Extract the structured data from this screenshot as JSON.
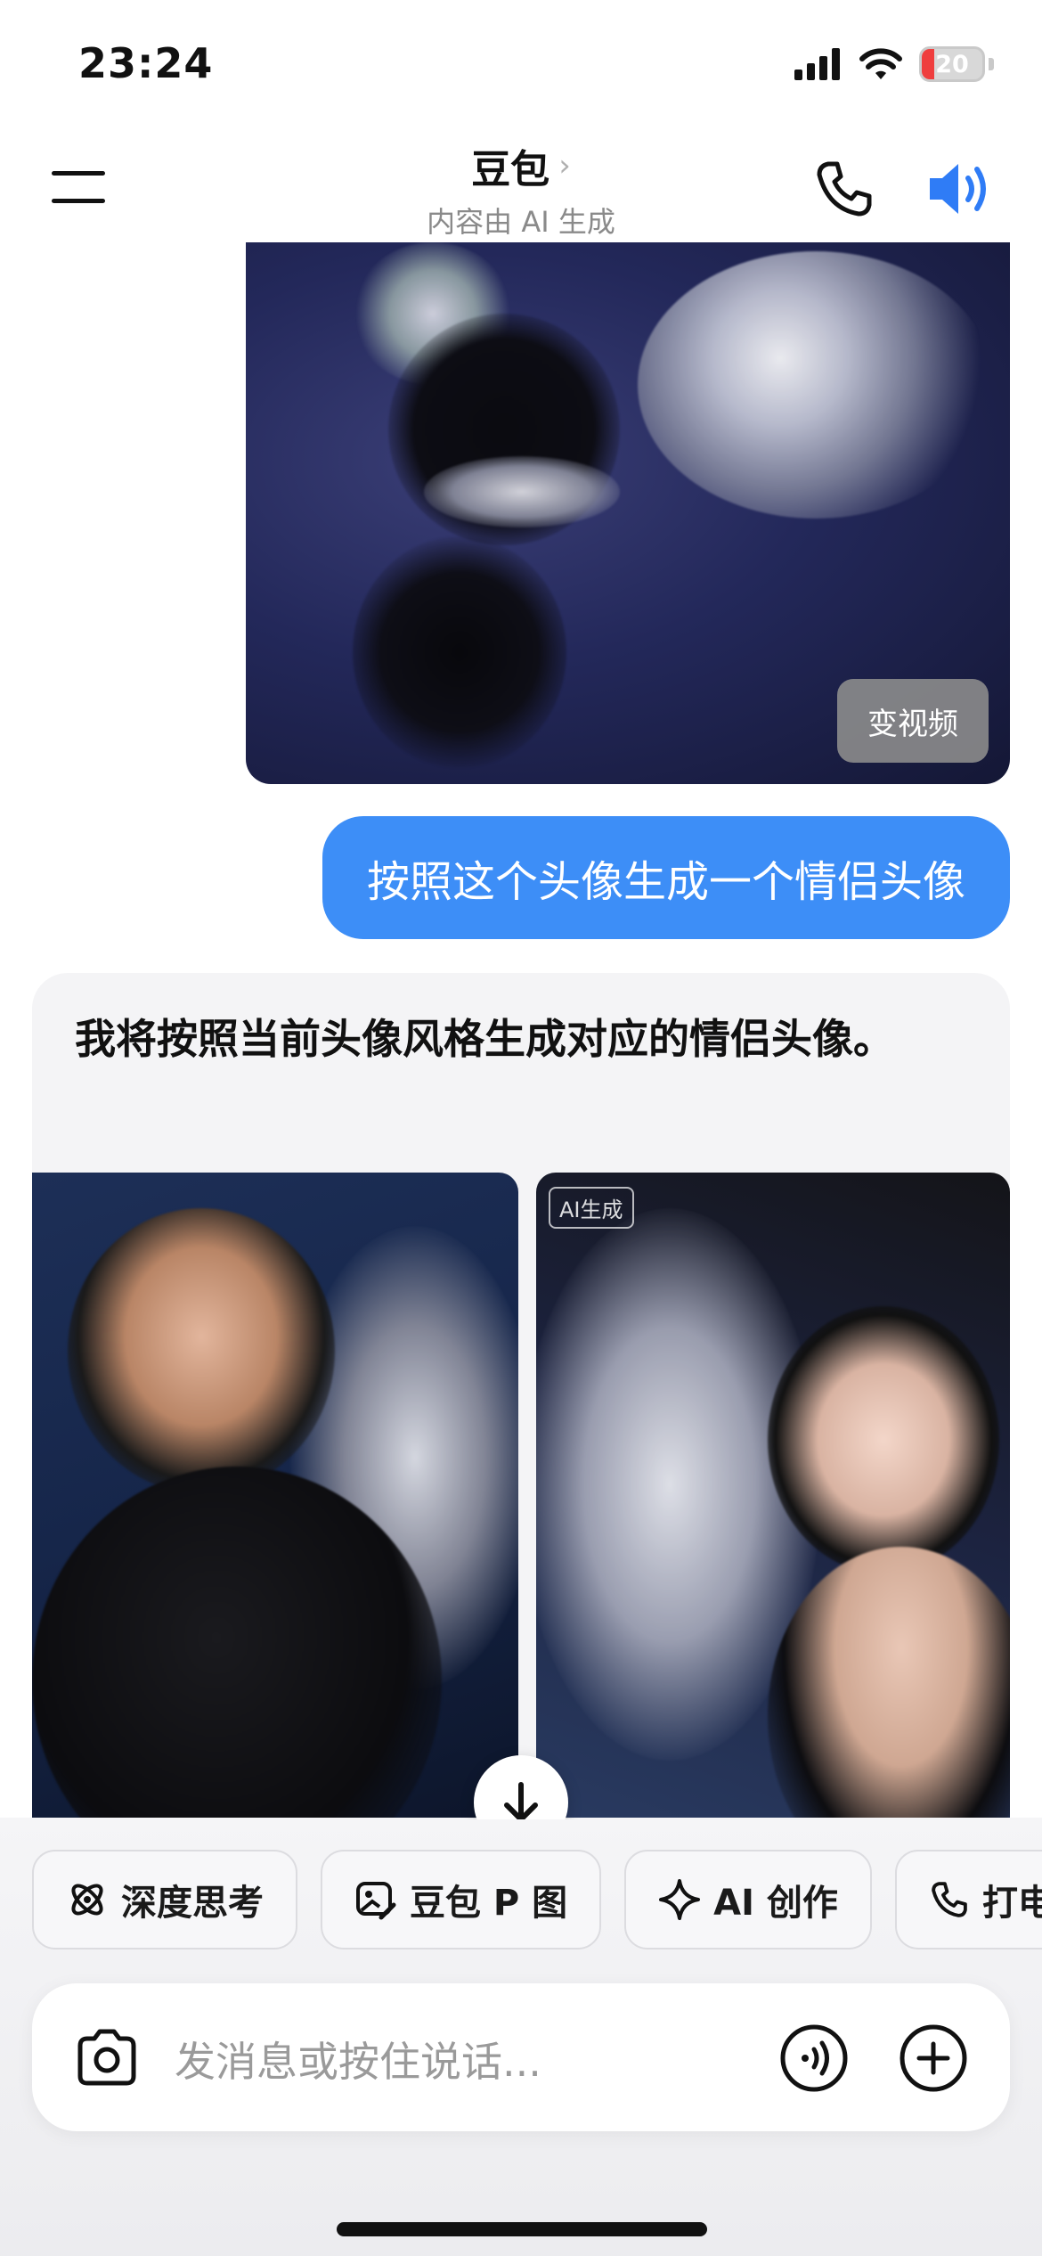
{
  "status": {
    "time": "23:24",
    "battery": "20",
    "battery_level": 0.2
  },
  "header": {
    "title": "豆包",
    "chevron": "›",
    "subtitle": "内容由 AI 生成"
  },
  "chat": {
    "image_action": "变视频",
    "user_message": "按照这个头像生成一个情侣头像",
    "bot_message": "我将按照当前头像风格生成对应的情侣头像。",
    "ai_badge": "AI生成"
  },
  "chips": [
    {
      "label": "深度思考",
      "icon": "atom-icon"
    },
    {
      "label": "豆包 P 图",
      "icon": "image-edit-icon"
    },
    {
      "label": "AI 创作",
      "icon": "sparkle-icon"
    },
    {
      "label": "打电话",
      "icon": "phone-icon"
    }
  ],
  "input": {
    "placeholder": "发消息或按住说话..."
  },
  "colors": {
    "accent": "#3d8ef7",
    "speaker": "#2f7cf6",
    "battery_low": "#ef3e3e"
  }
}
